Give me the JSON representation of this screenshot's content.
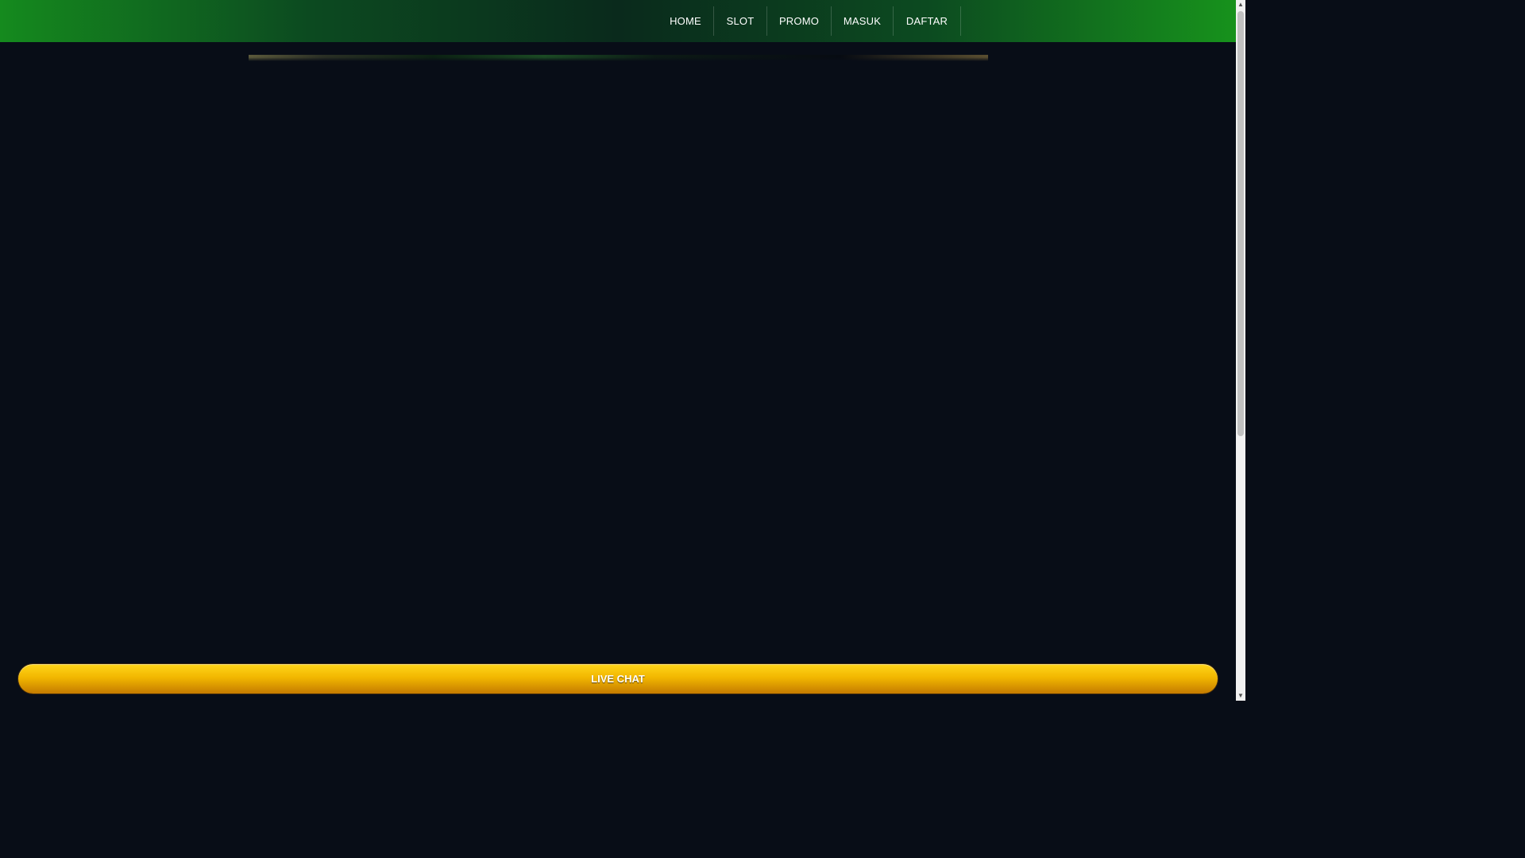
{
  "nav": {
    "items": [
      {
        "label": "HOME"
      },
      {
        "label": "SLOT"
      },
      {
        "label": "PROMO"
      },
      {
        "label": "MASUK"
      },
      {
        "label": "DAFTAR"
      }
    ]
  },
  "floating": {
    "live_chat_label": "LIVE CHAT"
  },
  "colors": {
    "header_accent": "#158a1e",
    "page_background": "#080d17",
    "live_chat_button": "#f2b700"
  }
}
